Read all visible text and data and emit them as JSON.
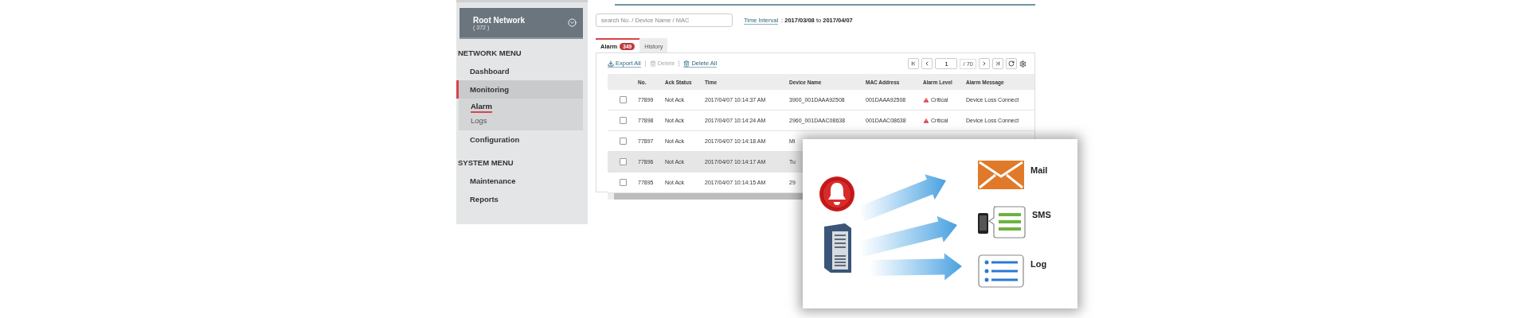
{
  "sidebar": {
    "network": {
      "name": "Root Network",
      "count": "( 372 )"
    },
    "sections": [
      {
        "title": "NETWORK MENU",
        "items": [
          {
            "label": "Dashboard",
            "selected": false
          },
          {
            "label": "Monitoring",
            "selected": true,
            "children": [
              {
                "label": "Alarm",
                "selected": true
              },
              {
                "label": "Logs",
                "selected": false
              }
            ]
          },
          {
            "label": "Configuration",
            "selected": false
          }
        ]
      },
      {
        "title": "SYSTEM MENU",
        "items": [
          {
            "label": "Maintenance",
            "selected": false
          },
          {
            "label": "Reports",
            "selected": false
          }
        ]
      }
    ]
  },
  "search": {
    "placeholder": "search No. / Device Name / MAC"
  },
  "time_interval": {
    "label": "Time Interval",
    "value": ": **2017/03/08** to **2017/04/07**"
  },
  "tabs": [
    {
      "label": "Alarm",
      "badge": "349",
      "selected": true
    },
    {
      "label": "History",
      "selected": false
    }
  ],
  "actions": [
    {
      "kind": "export",
      "label": "Export All",
      "disabled": false
    },
    {
      "kind": "delete",
      "label": "Delete",
      "disabled": true
    },
    {
      "kind": "delete",
      "label": "Delete All",
      "disabled": false
    }
  ],
  "pagination": {
    "page": "1",
    "total": "/ 70"
  },
  "table": {
    "columns": [
      "No.",
      "Ack Status",
      "Time",
      "Device Name",
      "MAC Address",
      "Alarm Level",
      "Alarm Message"
    ],
    "rows": [
      {
        "checked": false,
        "selected": false,
        "cells": [
          "77899",
          "Not Ack",
          "2017/04/07 10:14:37 AM",
          "3900_001DAAA92508",
          "001DAAA92508",
          "Critical",
          "Device Loss Connect"
        ]
      },
      {
        "checked": false,
        "selected": false,
        "cells": [
          "77898",
          "Not Ack",
          "2017/04/07 10:14:24 AM",
          "2960_001DAAC08638",
          "001DAAC08638",
          "Critical",
          "Device Loss Connect"
        ]
      },
      {
        "checked": false,
        "selected": false,
        "cells": [
          "77897",
          "Not Ack",
          "2017/04/07 10:14:18 AM",
          "Mi"
        ]
      },
      {
        "checked": false,
        "selected": true,
        "cells": [
          "77896",
          "Not Ack",
          "2017/04/07 10:14:17 AM",
          "Tu"
        ]
      },
      {
        "checked": false,
        "selected": false,
        "cells": [
          "77895",
          "Not Ack",
          "2017/04/07 10:14:15 AM",
          "29"
        ]
      }
    ]
  },
  "notifications": {
    "channels": [
      {
        "kind": "mail",
        "label": "Mail"
      },
      {
        "kind": "sms",
        "label": "SMS"
      },
      {
        "kind": "log",
        "label": "Log"
      }
    ]
  }
}
